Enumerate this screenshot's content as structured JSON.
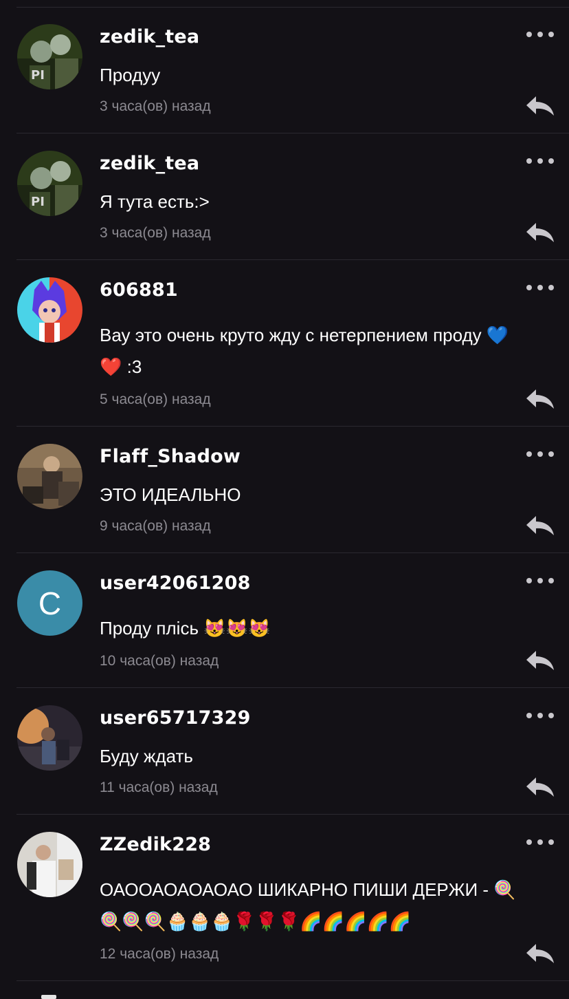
{
  "comments": [
    {
      "username": "zedik_tea",
      "text": "Продуу",
      "time": "3 часа(ов) назад",
      "avatar": "photo-two-people",
      "colors": [
        "#2c3b1a",
        "#b9c7b3",
        "#5e6b47"
      ]
    },
    {
      "username": "zedik_tea",
      "text": "Я тута есть:>",
      "time": "3 часа(ов) назад",
      "avatar": "photo-two-people",
      "colors": [
        "#2c3b1a",
        "#b9c7b3",
        "#5e6b47"
      ]
    },
    {
      "username": "606881",
      "text_line1": "Вау это очень круто жду с нетерпением проду 💙",
      "text_line2": "❤️ :3",
      "time": "5 часа(ов) назад",
      "avatar": "anime-character-blue-hair",
      "colors": [
        "#4ad3e8",
        "#e8462f",
        "#5b3be0"
      ]
    },
    {
      "username": "Flaff_Shadow",
      "text": "ЭТО ИДЕАЛЬНО",
      "time": "9 часа(ов) назад",
      "avatar": "photo-tattooed-man",
      "colors": [
        "#6e5a44",
        "#c8b49a",
        "#2a241f"
      ]
    },
    {
      "username": "user42061208",
      "text": "Проду плісь 😻😻😻",
      "time": "10 часа(ов) назад",
      "avatar": "letter-avatar",
      "letter": "C",
      "colors": [
        "#3a8ca8",
        "#ffffff"
      ]
    },
    {
      "username": "user65717329",
      "text": "Буду ждать",
      "time": "11 часа(ов) назад",
      "avatar": "photo-sunset-couple",
      "colors": [
        "#f0a35a",
        "#4a5a7a",
        "#2a2530"
      ]
    },
    {
      "username": "ZZedik228",
      "text_line1": "ОАООАОАОАОАО ШИКАРНО ПИШИ ДЕРЖИ - 🍭",
      "text_line2": "🍭🍭🍭🧁🧁🧁🌹🌹🌹🌈🌈🌈🌈🌈",
      "time": "12 часа(ов) назад",
      "avatar": "photo-selfie-mirror",
      "colors": [
        "#eeeeee",
        "#2a2a2a",
        "#c9b49a"
      ]
    }
  ],
  "icons": {
    "more": "more-dots-icon",
    "reply": "reply-arrow-icon"
  },
  "accent_colors": {
    "background": "#131116",
    "divider": "#2b2930",
    "timestamp": "#8c8a91",
    "icon": "#c9c7cc"
  }
}
